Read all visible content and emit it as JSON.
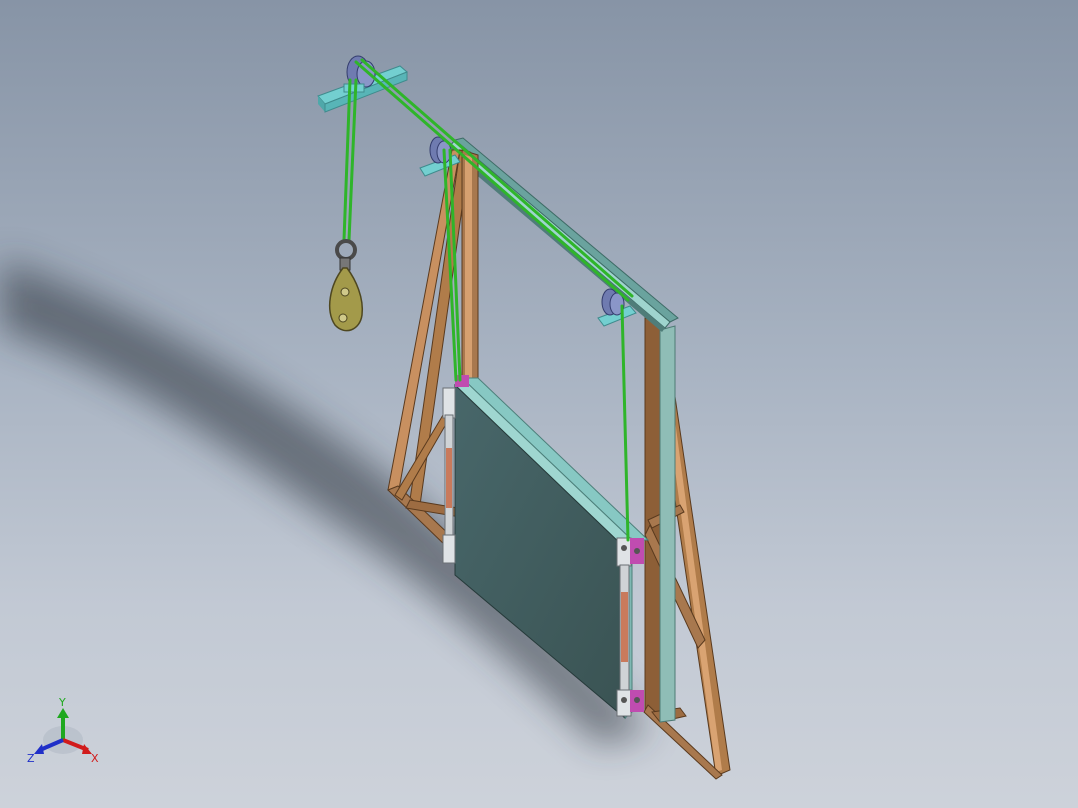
{
  "viewport": {
    "background_top": "#8794a6",
    "background_bottom": "#cdd2da"
  },
  "model": {
    "rope_color": "#2fb52a",
    "frame_color": "#a8784e",
    "panel_color": "#3e5958",
    "panel_edge_color": "#84c4c0",
    "bracket_color": "#6fc9c9",
    "pulley_color": "#6f7bb0",
    "hook_block_color": "#a39a4a"
  },
  "triad": {
    "x_label": "X",
    "y_label": "Y",
    "z_label": "Z",
    "x_color": "#d11b1b",
    "y_color": "#1fa81f",
    "z_color": "#2030c8"
  }
}
